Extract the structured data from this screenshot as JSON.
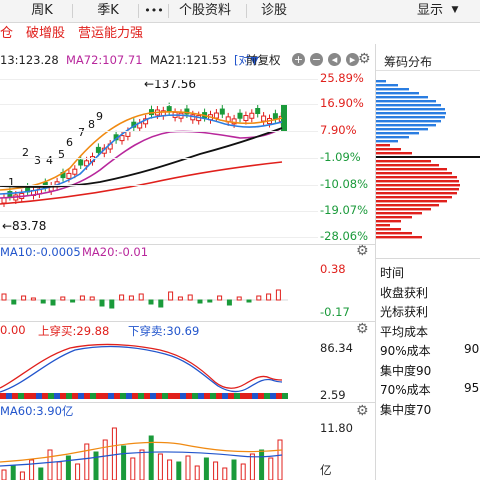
{
  "tabs": {
    "partial_left": "",
    "week": "周K",
    "season": "季K",
    "more": "•••",
    "profile": "个股资料",
    "diagnose": "诊股",
    "display": "显示",
    "display_arrow": "▼"
  },
  "tags": [
    "仓",
    "破增股",
    "营运能力强"
  ],
  "ma_bar": {
    "ma_a": "13:123.28",
    "ma72": "MA72:107.71",
    "ma21": "MA21:121.53",
    "adjust_mode": "对",
    "adjust_label": "前复权",
    "ma_a_color": "#e0201c",
    "ma72_color": "#b8279c",
    "ma21_color": "#222222"
  },
  "main_chart": {
    "high_label": "←137.56",
    "low_label": "←83.78",
    "wave_labels": [
      "1",
      "2",
      "3",
      "4",
      "5",
      "6",
      "7",
      "8",
      "9"
    ],
    "y_labels": [
      "25.89%",
      "16.90%",
      "7.90%",
      "-1.09%",
      "-10.08%",
      "-19.07%",
      "-28.06%"
    ],
    "y_label_colors": [
      "#e0201c",
      "#e0201c",
      "#e0201c",
      "#1a9a3a",
      "#1a9a3a",
      "#1a9a3a",
      "#1a9a3a"
    ]
  },
  "chip_panel": {
    "title": "筹码分布"
  },
  "macd": {
    "ma10": "MA10:-0.0005",
    "ma20": "MA20:-0.01",
    "top": "0.38",
    "bottom": "-0.17"
  },
  "osc": {
    "value1": "0.00",
    "upcross": "上穿买:29.88",
    "downcross": "下穿卖:30.69",
    "top": "86.34",
    "bottom": "2.59"
  },
  "volume": {
    "ma60": "MA60:3.90亿",
    "top": "11.80",
    "unit": "亿"
  },
  "info_panel": {
    "rows": [
      {
        "label": "时间",
        "value": ""
      },
      {
        "label": "收盘获利",
        "value": ""
      },
      {
        "label": "光标获利",
        "value": ""
      },
      {
        "label": "平均成本",
        "value": ""
      },
      {
        "label": "90%成本",
        "value": "90."
      },
      {
        "label": "集中度90",
        "value": ""
      },
      {
        "label": "70%成本",
        "value": "95."
      },
      {
        "label": "集中度70",
        "value": ""
      }
    ]
  }
}
